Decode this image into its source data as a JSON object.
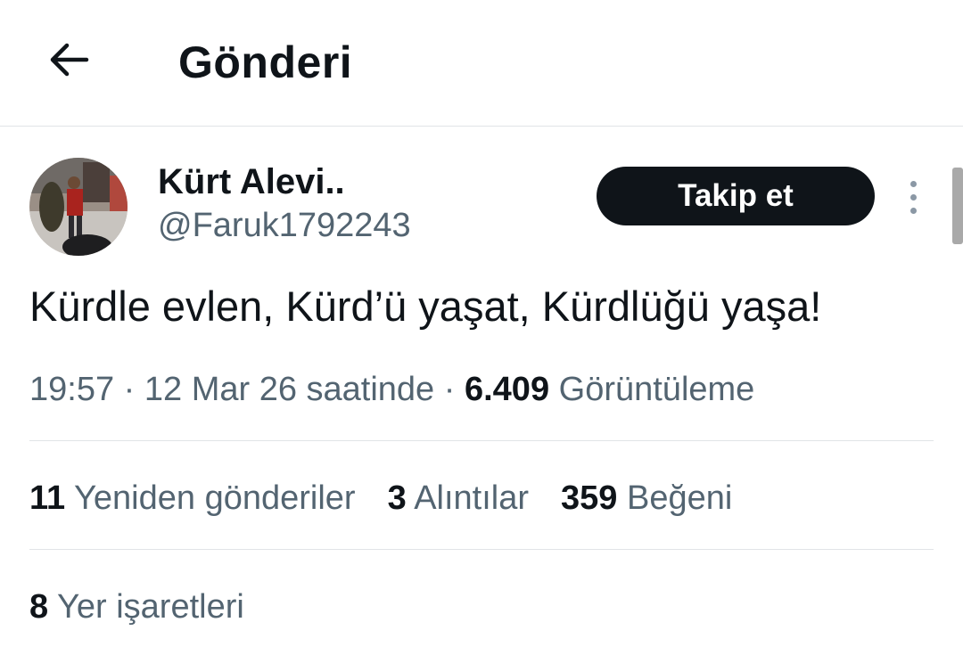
{
  "header": {
    "title": "Gönderi"
  },
  "tweet": {
    "author_name": "Kürt Alevi..",
    "author_handle": "@Faruk1792243",
    "follow_label": "Takip et",
    "text": "Kürdle evlen, Kürd’ü yaşat, Kürdlüğü yaşa!",
    "time": "19:57",
    "date": "12 Mar 26 saatinde",
    "separator": "·",
    "views_count": "6.409",
    "views_label": "Görüntüleme"
  },
  "stats": {
    "retweets_count": "11",
    "retweets_label": "Yeniden gönderiler",
    "quotes_count": "3",
    "quotes_label": "Alıntılar",
    "likes_count": "359",
    "likes_label": "Beğeni",
    "bookmarks_count": "8",
    "bookmarks_label": "Yer işaretleri"
  },
  "colors": {
    "primary_text": "#0f1419",
    "secondary_text": "#536471",
    "divider": "#e1e4e7",
    "follow_bg": "#0f1419",
    "follow_text": "#ffffff"
  },
  "icons": {
    "back": "arrow-left-icon",
    "more": "more-vertical-icon"
  }
}
